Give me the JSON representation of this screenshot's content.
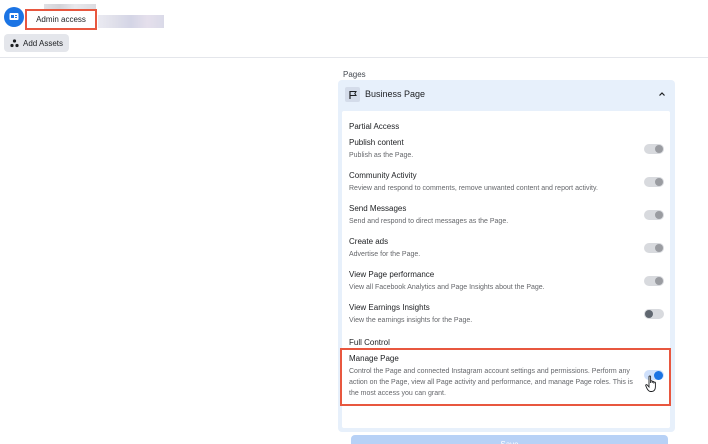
{
  "header": {
    "admin_label": "Admin access",
    "add_assets_label": "Add Assets"
  },
  "panel": {
    "section_label": "Pages",
    "page_name": "Business Page",
    "partial_access_label": "Partial Access",
    "full_control_label": "Full Control",
    "permissions": [
      {
        "title": "Publish content",
        "description": "Publish as the Page.",
        "enabled": true,
        "disabled": true
      },
      {
        "title": "Community Activity",
        "description": "Review and respond to comments, remove unwanted content and report activity.",
        "enabled": true,
        "disabled": true
      },
      {
        "title": "Send Messages",
        "description": "Send and respond to direct messages as the Page.",
        "enabled": true,
        "disabled": true
      },
      {
        "title": "Create ads",
        "description": "Advertise for the Page.",
        "enabled": true,
        "disabled": true
      },
      {
        "title": "View Page performance",
        "description": "View all Facebook Analytics and Page Insights about the Page.",
        "enabled": true,
        "disabled": true
      },
      {
        "title": "View Earnings Insights",
        "description": "View the earnings insights for the Page.",
        "enabled": false,
        "disabled": false
      }
    ],
    "manage_page": {
      "title": "Manage Page",
      "description": "Control the Page and connected Instagram account settings and permissions. Perform any action on the Page, view all Page activity and performance, and manage Page roles. This is the most access you can grant.",
      "enabled": true
    },
    "save_label": "Save"
  },
  "colors": {
    "accent": "#1b74e4",
    "highlight": "#e8573f",
    "panel_bg": "#e7f0fb"
  },
  "icons": [
    "avatar-icon",
    "add-assets-icon",
    "flag-icon",
    "chevron-up-icon",
    "pointer-cursor-icon"
  ]
}
